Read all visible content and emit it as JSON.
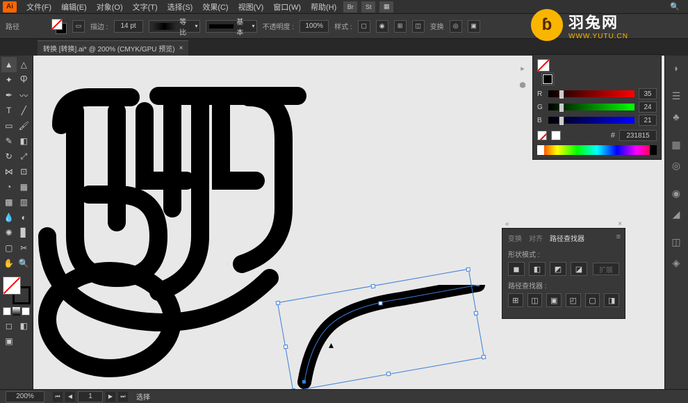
{
  "app_icon": "Ai",
  "menu": {
    "file": "文件(F)",
    "edit": "编辑(E)",
    "object": "对象(O)",
    "type": "文字(T)",
    "select": "选择(S)",
    "effect": "效果(C)",
    "view": "视图(V)",
    "window": "窗口(W)",
    "help": "帮助(H)"
  },
  "control": {
    "selection_label": "路径",
    "stroke_label": "描边 :",
    "stroke_weight": "14 pt",
    "profile_label": "等比",
    "brush_label": "基本",
    "opacity_label": "不透明度 :",
    "opacity_value": "100%",
    "style_label": "样式 :",
    "transform_label": "变换"
  },
  "tab": {
    "title": "转换  [转换].ai* @ 200% (CMYK/GPU 预览)"
  },
  "color_panel": {
    "r_label": "R",
    "r_value": "35",
    "g_label": "G",
    "g_value": "24",
    "b_label": "B",
    "b_value": "21",
    "hash": "#",
    "hex": "231815"
  },
  "pathfinder": {
    "tab_transform": "变换",
    "tab_align": "对齐",
    "tab_pathfinder": "路径查找器",
    "shape_modes_label": "形状模式 :",
    "expand_label": "扩展",
    "pathfinders_label": "路径查找器 :"
  },
  "status": {
    "zoom": "200%",
    "artboard_nav": "1",
    "tool": "选择"
  },
  "watermark": {
    "cn": "羽兔网",
    "en": "WWW.YUTU.CN"
  }
}
